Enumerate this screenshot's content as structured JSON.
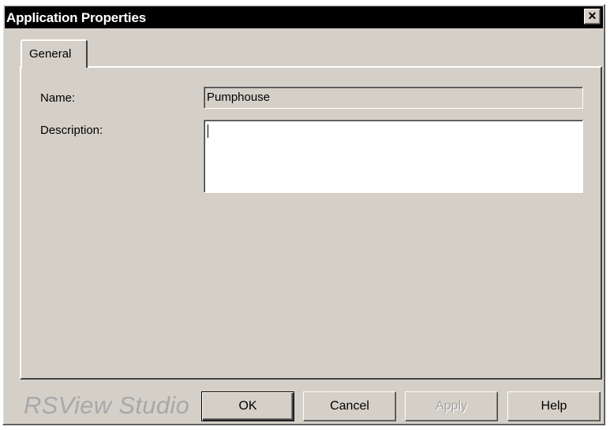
{
  "window": {
    "title": "Application Properties",
    "close_glyph": "✕"
  },
  "tabs": [
    {
      "label": "General",
      "selected": true
    }
  ],
  "form": {
    "name_label": "Name:",
    "name_value": "Pumphouse",
    "description_label": "Description:",
    "description_value": ""
  },
  "footer": {
    "brand": "RSView Studio",
    "ok_label": "OK",
    "cancel_label": "Cancel",
    "apply_label": "Apply",
    "help_label": "Help"
  },
  "colors": {
    "dialog_face": "#d4d0c8",
    "titlebar": "#000000",
    "brand_text": "#a8a8a8"
  },
  "icons": {
    "close": "close-icon"
  }
}
